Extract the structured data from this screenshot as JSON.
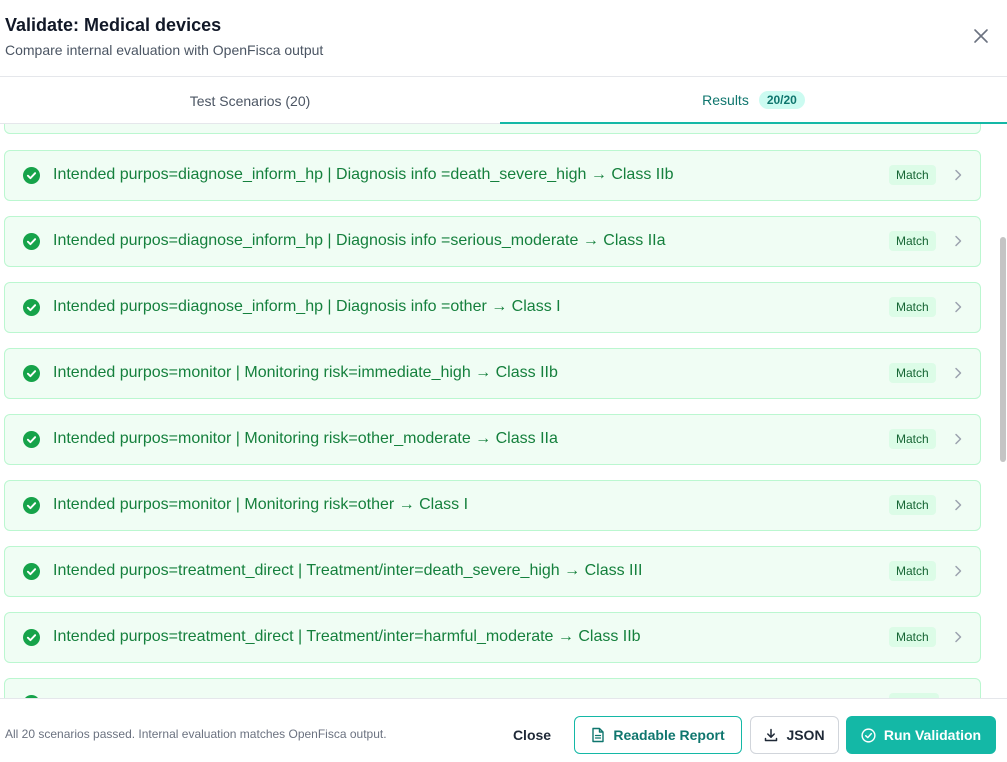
{
  "header": {
    "title": "Validate: Medical devices",
    "subtitle": "Compare internal evaluation with OpenFisca output"
  },
  "tabs": {
    "scenarios_label": "Test Scenarios (20)",
    "results_label": "Results",
    "results_badge": "20/20"
  },
  "results": [
    {
      "text": "Intended purpos=diagnose_inform_hp | Diagnosis info =death_severe_high → Class IIb",
      "status": "Match"
    },
    {
      "text": "Intended purpos=diagnose_inform_hp | Diagnosis info =serious_moderate → Class IIa",
      "status": "Match"
    },
    {
      "text": "Intended purpos=diagnose_inform_hp | Diagnosis info =other → Class I",
      "status": "Match"
    },
    {
      "text": "Intended purpos=monitor | Monitoring risk=immediate_high → Class IIb",
      "status": "Match"
    },
    {
      "text": "Intended purpos=monitor | Monitoring risk=other_moderate → Class IIa",
      "status": "Match"
    },
    {
      "text": "Intended purpos=monitor | Monitoring risk=other → Class I",
      "status": "Match"
    },
    {
      "text": "Intended purpos=treatment_direct | Treatment/inter=death_severe_high → Class III",
      "status": "Match"
    },
    {
      "text": "Intended purpos=treatment_direct | Treatment/inter=harmful_moderate → Class IIb",
      "status": "Match"
    }
  ],
  "footer": {
    "status_text": "All 20 scenarios passed. Internal evaluation matches OpenFisca output.",
    "close_label": "Close",
    "report_label": "Readable Report",
    "json_label": "JSON",
    "run_label": "Run Validation"
  },
  "colors": {
    "accent": "#14b8a6",
    "success": "#16a34a",
    "row_bg": "#f0fdf4"
  }
}
